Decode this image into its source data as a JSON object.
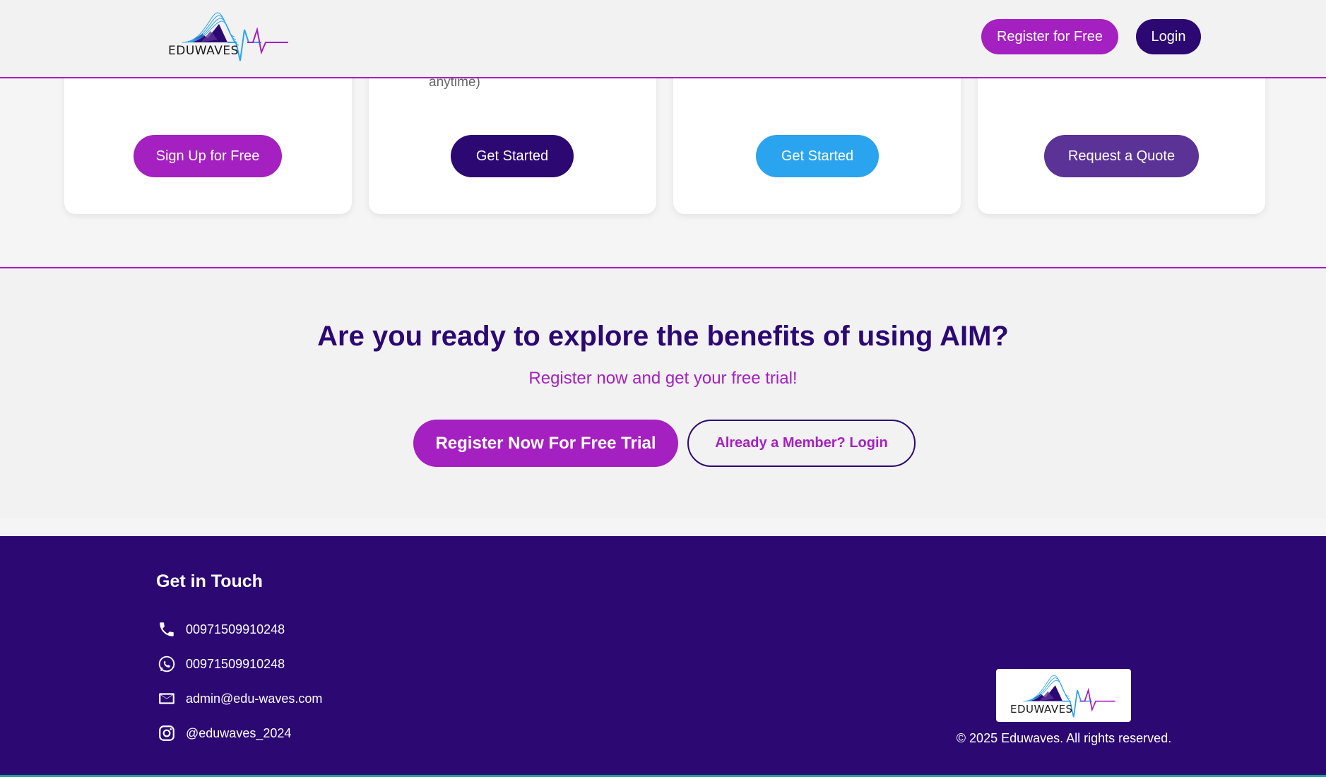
{
  "brand": {
    "name": "EDUWAVES"
  },
  "header": {
    "register_label": "Register for Free",
    "login_label": "Login"
  },
  "cards": [
    {
      "note": "",
      "button": "Sign Up for Free"
    },
    {
      "note": "anytime)",
      "button": "Get Started"
    },
    {
      "note": "",
      "button": "Get Started"
    },
    {
      "note": "",
      "button": "Request a Quote"
    }
  ],
  "cta": {
    "title": "Are you ready to explore the benefits of using AIM?",
    "subtitle": "Register now and get your free trial!",
    "primary_button": "Register Now For Free Trial",
    "secondary_button": "Already a Member? Login"
  },
  "footer": {
    "heading": "Get in Touch",
    "phone": "00971509910248",
    "whatsapp": "00971509910248",
    "email": "admin@edu-waves.com",
    "instagram": "@eduwaves_2024",
    "copyright": "© 2025 Eduwaves. All rights reserved."
  },
  "colors": {
    "brand_purple": "#a520c0",
    "deep_indigo": "#2c0873",
    "sky_blue": "#2ba4ef",
    "violet": "#5b3296",
    "footer_bg": "#2c0873"
  },
  "icons": [
    "eduwaves-logo",
    "phone-icon",
    "whatsapp-icon",
    "email-icon",
    "instagram-icon"
  ]
}
